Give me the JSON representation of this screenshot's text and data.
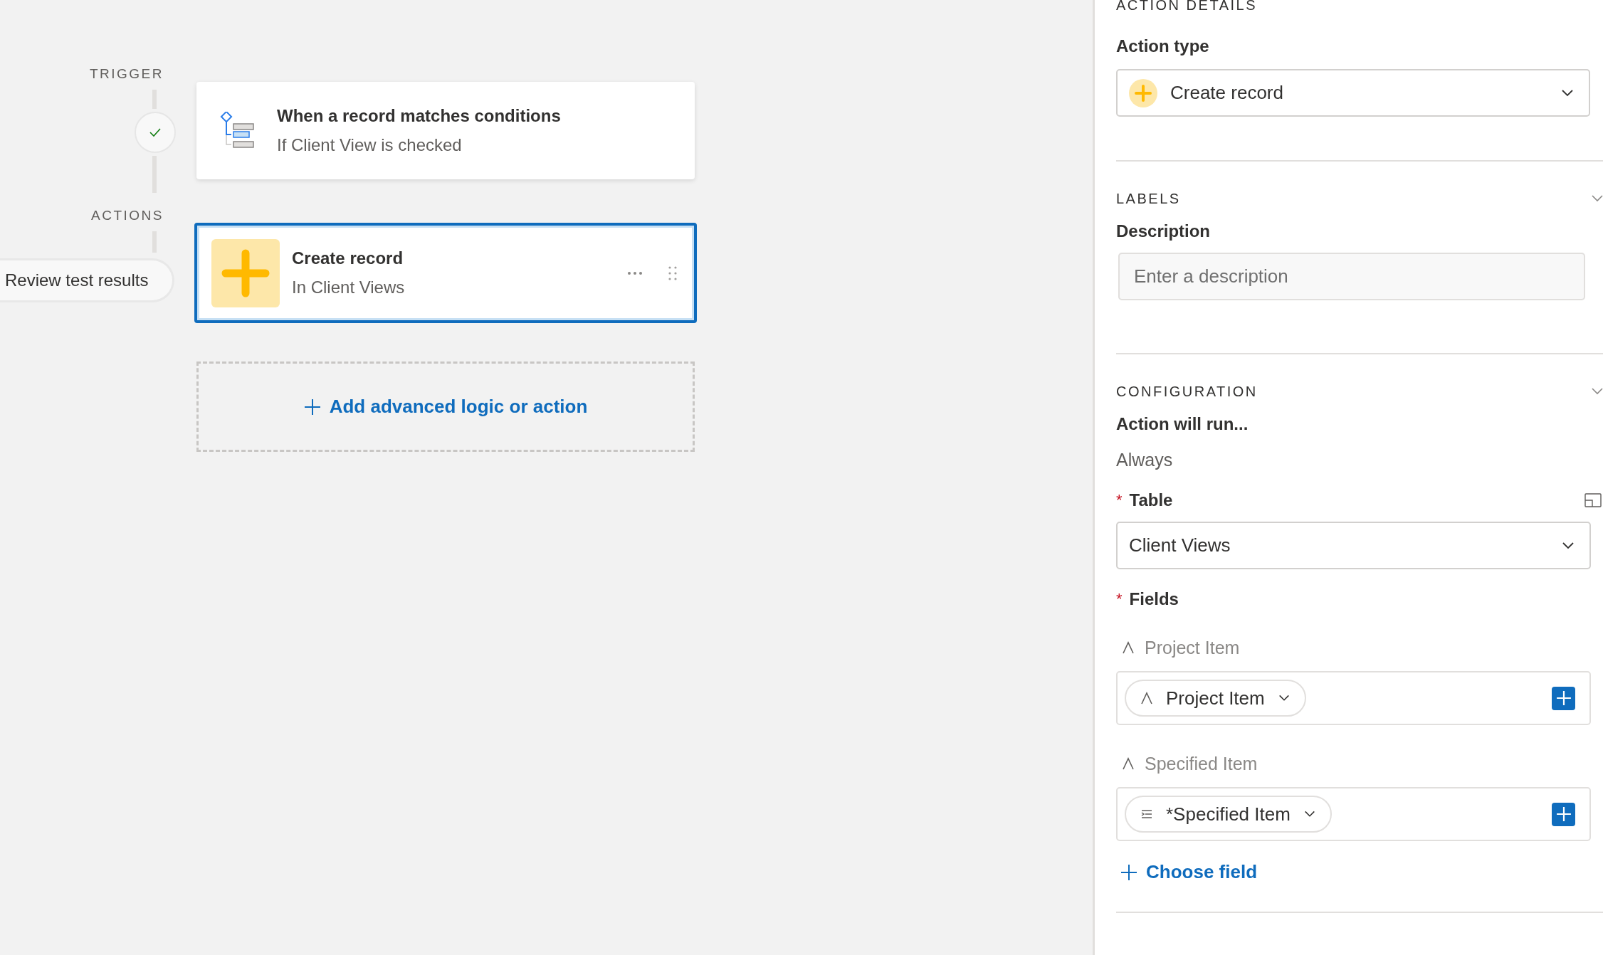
{
  "canvas": {
    "trigger_label": "TRIGGER",
    "actions_label": "ACTIONS",
    "review_button": "Review test results",
    "trigger_card": {
      "title": "When a record matches conditions",
      "subtitle": "If Client View is checked"
    },
    "action_card": {
      "title": "Create record",
      "subtitle": "In Client Views",
      "selected": true
    },
    "add_button": "Add advanced logic or action"
  },
  "panel": {
    "title": "ACTION DETAILS",
    "action_type_label": "Action type",
    "action_type_value": "Create record",
    "labels": {
      "title": "LABELS",
      "description_label": "Description",
      "placeholder": "Enter a description"
    },
    "configuration": {
      "title": "CONFIGURATION",
      "run_label": "Action will run...",
      "run_value": "Always",
      "table_marker": "*",
      "table_label": "Table",
      "table_value": "Client Views",
      "fields_marker": "*",
      "fields_label": "Fields",
      "fields": [
        {
          "label": "Project Item",
          "chip": "Project Item",
          "kind": "text"
        },
        {
          "label": "Specified Item",
          "chip": "*Specified Item",
          "kind": "list"
        }
      ],
      "choose_field": "Choose field"
    }
  }
}
